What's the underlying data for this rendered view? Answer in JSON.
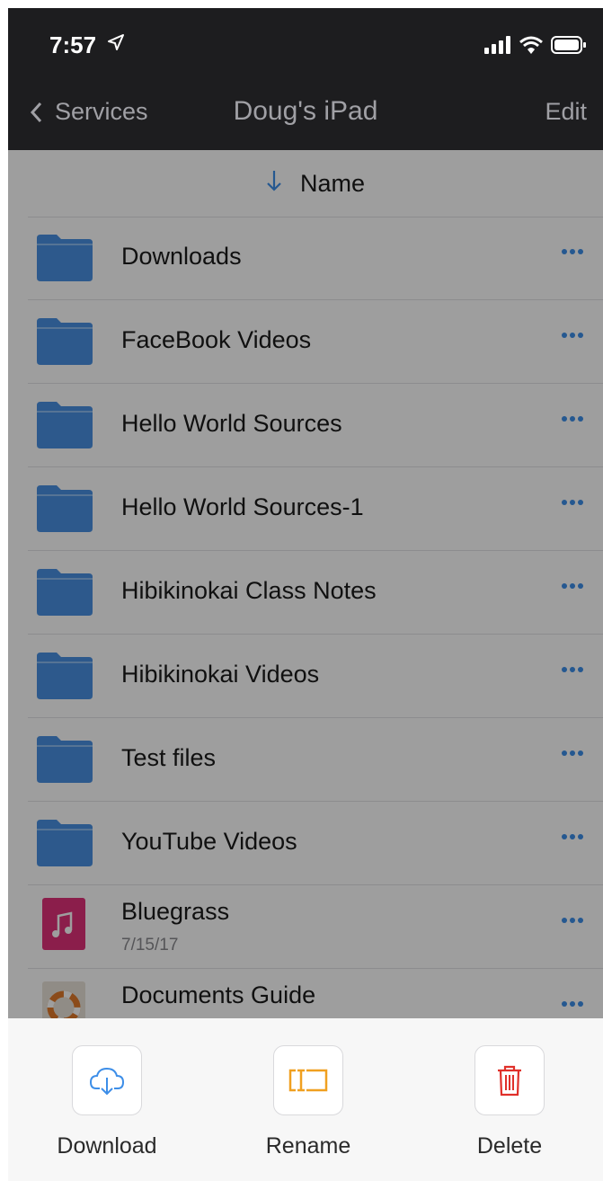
{
  "status": {
    "time": "7:57"
  },
  "nav": {
    "back_label": "Services",
    "title": "Doug's iPad",
    "edit_label": "Edit"
  },
  "sort": {
    "label": "Name"
  },
  "files": [
    {
      "name": "Downloads",
      "type": "folder"
    },
    {
      "name": "FaceBook Videos",
      "type": "folder"
    },
    {
      "name": "Hello World Sources",
      "type": "folder"
    },
    {
      "name": "Hello World Sources-1",
      "type": "folder"
    },
    {
      "name": "Hibikinokai Class Notes",
      "type": "folder"
    },
    {
      "name": "Hibikinokai Videos",
      "type": "folder"
    },
    {
      "name": "Test files",
      "type": "folder"
    },
    {
      "name": "YouTube Videos",
      "type": "folder"
    },
    {
      "name": "Bluegrass",
      "date": "7/15/17",
      "type": "music"
    },
    {
      "name": "Documents Guide",
      "type": "guide"
    }
  ],
  "actions": {
    "download": "Download",
    "rename": "Rename",
    "delete": "Delete"
  },
  "colors": {
    "accent": "#3d8ee8",
    "folder": "#4a90e2",
    "music": "#e0317a",
    "rename": "#f0a020",
    "delete": "#e0302a"
  }
}
